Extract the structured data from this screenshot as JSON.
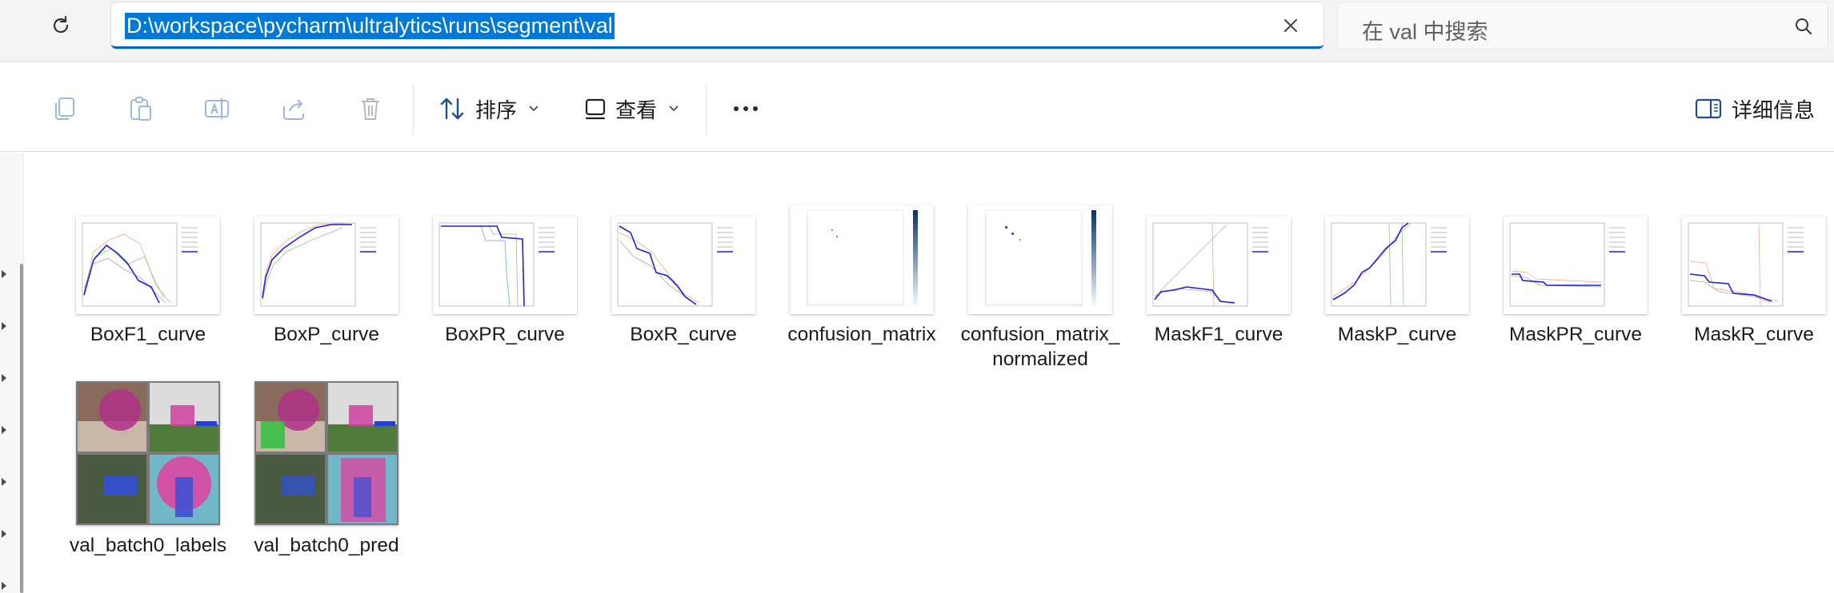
{
  "address_bar": {
    "path": "D:\\workspace\\pycharm\\ultralytics\\runs\\segment\\val"
  },
  "search": {
    "placeholder": "在 val 中搜索"
  },
  "toolbar": {
    "sort_label": "排序",
    "view_label": "查看",
    "details_label": "详细信息",
    "icons": [
      "copy-icon",
      "paste-icon",
      "rename-icon",
      "share-icon",
      "delete-icon",
      "sort-icon",
      "view-icon",
      "more-icon",
      "details-pane-icon"
    ]
  },
  "files": [
    {
      "name": "BoxF1_curve",
      "kind": "curve"
    },
    {
      "name": "BoxP_curve",
      "kind": "curve"
    },
    {
      "name": "BoxPR_curve",
      "kind": "curve"
    },
    {
      "name": "BoxR_curve",
      "kind": "curve"
    },
    {
      "name": "confusion_matrix",
      "kind": "matrix"
    },
    {
      "name": "confusion_matrix_normalized",
      "kind": "matrix"
    },
    {
      "name": "MaskF1_curve",
      "kind": "curve"
    },
    {
      "name": "MaskP_curve",
      "kind": "curve"
    },
    {
      "name": "MaskPR_curve",
      "kind": "curve"
    },
    {
      "name": "MaskR_curve",
      "kind": "curve"
    },
    {
      "name": "val_batch0_labels",
      "kind": "photo"
    },
    {
      "name": "val_batch0_pred",
      "kind": "photo"
    }
  ],
  "colors": {
    "accent": "#0067c0",
    "selection": "#0078d7",
    "curve_blue": "#1f1fd6",
    "curve_orange": "#f4a582",
    "overlay_pink": "#e040a0"
  }
}
